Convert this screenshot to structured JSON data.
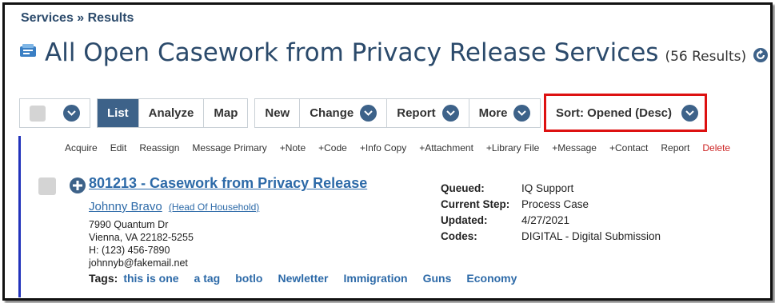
{
  "breadcrumb": "Services » Results",
  "title": "All Open Casework from Privacy Release Services",
  "result_count": "(56 Results)",
  "toolbar": {
    "view_buttons": [
      "List",
      "Analyze",
      "Map"
    ],
    "new": "New",
    "change": "Change",
    "report": "Report",
    "more": "More",
    "sort": "Sort: Opened (Desc)"
  },
  "actions": [
    "Acquire",
    "Edit",
    "Reassign",
    "Message Primary",
    "+Note",
    "+Code",
    "+Info Copy",
    "+Attachment",
    "+Library File",
    "+Message",
    "+Contact",
    "Report",
    "Delete"
  ],
  "item": {
    "title": "801213 - Casework from Privacy Release",
    "person_name": "Johnny Bravo",
    "person_role": "(Head Of Household)",
    "address_line1": "7990 Quantum Dr",
    "address_line2": "Vienna, VA 22182-5255",
    "phone": "H: (123) 456-7890",
    "email": "johnnyb@fakemail.net",
    "tags_label": "Tags:",
    "tags": [
      "this is one",
      "a tag",
      "botlo",
      "Newletter",
      "Immigration",
      "Guns",
      "Economy"
    ],
    "details": [
      {
        "label": "Queued:",
        "value": "IQ Support"
      },
      {
        "label": "Current Step:",
        "value": "Process Case"
      },
      {
        "label": "Updated:",
        "value": "4/27/2021"
      },
      {
        "label": "Codes:",
        "value": "DIGITAL - Digital Submission"
      }
    ]
  },
  "colors": {
    "accent": "#3d6289",
    "link": "#2d6aa8",
    "title": "#2b4a6b",
    "highlight": "#dd1111",
    "panel_border": "#2233bb"
  }
}
